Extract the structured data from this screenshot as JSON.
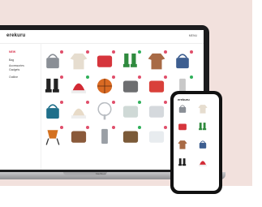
{
  "app": {
    "brand": "erekuru",
    "menu_link": "MENU"
  },
  "sidebar": {
    "items": [
      {
        "label": "NEW",
        "active": true
      },
      {
        "label": "Bag",
        "active": false
      },
      {
        "label": "Accessories",
        "active": false
      },
      {
        "label": "Gadgets",
        "active": false
      },
      {
        "label": "Outline",
        "active": false
      }
    ]
  },
  "grid_items": [
    {
      "icon": "handbag-icon",
      "color": "#8a8f96",
      "pin": "#e04e6a"
    },
    {
      "icon": "sweater-icon",
      "color": "#e6ddcf",
      "pin": "#e04e6a"
    },
    {
      "icon": "red-case-icon",
      "color": "#d6353c",
      "pin": "#e04e6a"
    },
    {
      "icon": "rain-boots-icon",
      "color": "#2f8a3e",
      "pin": "#2fb05a"
    },
    {
      "icon": "coat-icon",
      "color": "#a86a45",
      "pin": "#e04e6a"
    },
    {
      "icon": "blue-bag-icon",
      "color": "#3d5e90",
      "pin": "#e04e6a"
    },
    {
      "icon": "black-boots-icon",
      "color": "#222",
      "pin": "#e04e6a"
    },
    {
      "icon": "santa-hat-icon",
      "color": "#d22a34",
      "pin": "#2fb05a"
    },
    {
      "icon": "basketball-icon",
      "color": "#d96a23",
      "pin": "#e04e6a"
    },
    {
      "icon": "tools-icon",
      "color": "#6d6e70",
      "pin": "#e04e6a"
    },
    {
      "icon": "red-box-icon",
      "color": "#d9403a",
      "pin": "#e04e6a"
    },
    {
      "icon": "lamp-icon",
      "color": "#c8c8c8",
      "pin": "#2fb05a"
    },
    {
      "icon": "sleeping-bag-icon",
      "color": "#1f6f8a",
      "pin": "#e04e6a"
    },
    {
      "icon": "beanie-icon",
      "color": "#e8dbc8",
      "pin": "#e04e6a"
    },
    {
      "icon": "fan-icon",
      "color": "#b9bdc2",
      "pin": "#e04e6a"
    },
    {
      "icon": "teapot-icon",
      "color": "#cfd9d6",
      "pin": "#2fb05a"
    },
    {
      "icon": "kettle-icon",
      "color": "#d5d9dd",
      "pin": "#e04e6a"
    },
    {
      "icon": "blue-carrier-icon",
      "color": "#2c5d8a",
      "pin": "#e04e6a"
    },
    {
      "icon": "camp-chair-icon",
      "color": "#d4711f",
      "pin": "#e04e6a"
    },
    {
      "icon": "game-board-icon",
      "color": "#8a5a3a",
      "pin": "#e04e6a"
    },
    {
      "icon": "heater-icon",
      "color": "#9a9fa5",
      "pin": "#e04e6a"
    },
    {
      "icon": "sleeping-pad-icon",
      "color": "#7b5a38",
      "pin": "#2fb05a"
    },
    {
      "icon": "humidifier-icon",
      "color": "#e8ecef",
      "pin": "#e04e6a"
    },
    {
      "icon": "blank-icon",
      "color": "#ffffff",
      "pin": "#ffffff"
    }
  ],
  "base_label": "MacBook",
  "phone": {
    "brand": "erekuru"
  },
  "phone_items": [
    {
      "icon": "handbag-icon",
      "color": "#8a8f96"
    },
    {
      "icon": "sweater-icon",
      "color": "#e6ddcf"
    },
    {
      "icon": "red-case-icon",
      "color": "#d6353c"
    },
    {
      "icon": "rain-boots-icon",
      "color": "#2f8a3e"
    },
    {
      "icon": "coat-icon",
      "color": "#a86a45"
    },
    {
      "icon": "blue-bag-icon",
      "color": "#3d5e90"
    },
    {
      "icon": "black-boots-icon",
      "color": "#222"
    },
    {
      "icon": "santa-hat-icon",
      "color": "#d22a34"
    }
  ]
}
